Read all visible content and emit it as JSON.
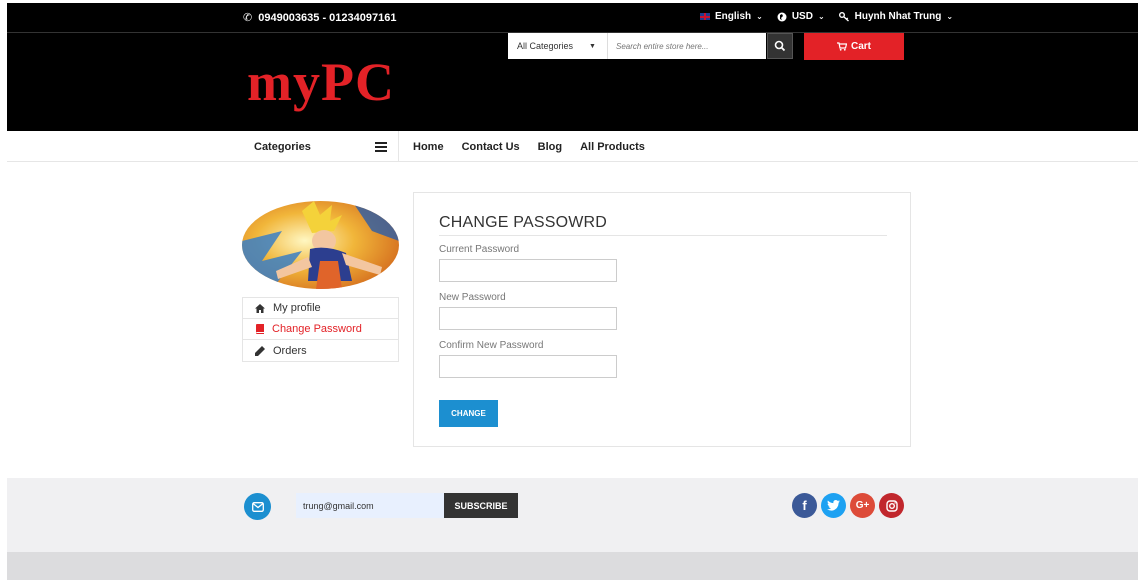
{
  "topbar": {
    "phone": "0949003635 - 01234097161",
    "language": "English",
    "currency": "USD",
    "user": "Huynh Nhat Trung"
  },
  "header": {
    "logo": "myPC",
    "search_category": "All Categories",
    "search_placeholder": "Search entire store here...",
    "cart_label": "Cart"
  },
  "nav": {
    "categories_label": "Categories",
    "menu": [
      "Home",
      "Contact Us",
      "Blog",
      "All Products"
    ]
  },
  "sidebar": {
    "items": [
      {
        "label": "My profile",
        "icon": "home-icon"
      },
      {
        "label": "Change Password",
        "icon": "book-icon"
      },
      {
        "label": "Orders",
        "icon": "pencil-icon"
      }
    ]
  },
  "form": {
    "title": "CHANGE PASSOWRD",
    "current_label": "Current Password",
    "new_label": "New Password",
    "confirm_label": "Confirm New Password",
    "submit_label": "CHANGE"
  },
  "footer": {
    "email_value": "trung@gmail.com",
    "subscribe_label": "SUBSCRIBE",
    "socials": [
      "facebook-icon",
      "twitter-icon",
      "google-plus-icon",
      "instagram-icon"
    ]
  },
  "colors": {
    "brand_red": "#e32227",
    "accent_blue": "#1c8fd0",
    "dark": "#000000"
  }
}
